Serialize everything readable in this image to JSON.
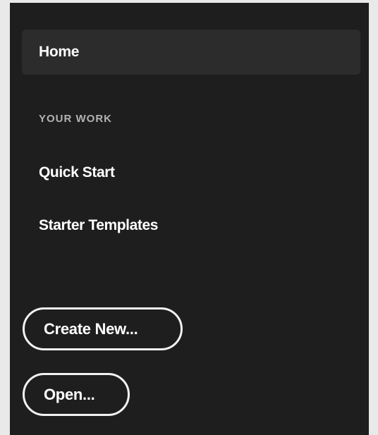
{
  "sidebar": {
    "home_label": "Home",
    "section_label": "YOUR WORK",
    "items": [
      {
        "label": "Quick Start"
      },
      {
        "label": "Starter Templates"
      }
    ]
  },
  "actions": {
    "create_new_label": "Create New...",
    "open_label": "Open..."
  },
  "colors": {
    "panel_background": "#1e1e1e",
    "selected_item_background": "#2c2c2c",
    "outer_background": "#e9e9e9",
    "text": "#ffffff",
    "section_label": "#b3b3b3",
    "button_border": "#f2f2f2"
  }
}
